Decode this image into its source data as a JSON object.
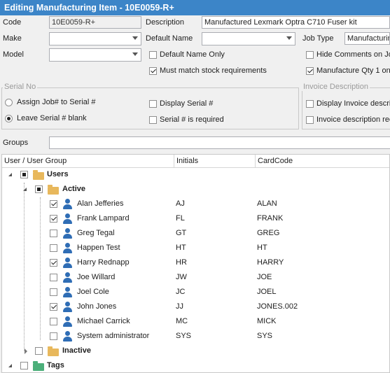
{
  "window": {
    "title": "Editing Manufacturing Item - 10E0059-R+"
  },
  "form": {
    "code_label": "Code",
    "code_value": "10E0059-R+",
    "description_label": "Description",
    "description_value": "Manufactured Lexmark Optra C710 Fuser kit",
    "make_label": "Make",
    "make_value": "",
    "default_name_label": "Default Name",
    "default_name_value": "",
    "job_type_label": "Job Type",
    "job_type_value": "Manufacturin",
    "model_label": "Model",
    "model_value": "",
    "default_name_only_label": "Default Name Only",
    "default_name_only_checked": false,
    "hide_comments_label": "Hide Comments on Jol",
    "hide_comments_checked": false,
    "must_match_label": "Must match stock requirements",
    "must_match_checked": true,
    "manufacture_qty_label": "Manufacture Qty 1 on",
    "manufacture_qty_checked": true
  },
  "serial_group": {
    "title": "Serial No",
    "assign_label": "Assign Job# to Serial #",
    "leave_blank_label": "Leave Serial # blank",
    "selected": "leave_blank",
    "display_serial_label": "Display Serial #",
    "serial_required_label": "Serial # is required"
  },
  "invoice_group": {
    "title": "Invoice Description",
    "display_invoice_label": "Display Invoice descri",
    "invoice_required_label": "Invoice description rec"
  },
  "groups": {
    "label": "Groups",
    "value": ""
  },
  "grid": {
    "columns": [
      "User / User Group",
      "Initials",
      "CardCode"
    ],
    "root": {
      "label": "Users"
    },
    "active": {
      "label": "Active"
    },
    "users": [
      {
        "name": "Alan Jefferies",
        "initials": "AJ",
        "card": "ALAN",
        "checked": true
      },
      {
        "name": "Frank Lampard",
        "initials": "FL",
        "card": "FRANK",
        "checked": true
      },
      {
        "name": "Greg Tegal",
        "initials": "GT",
        "card": "GREG",
        "checked": false
      },
      {
        "name": "Happen Test",
        "initials": "HT",
        "card": "HT",
        "checked": false
      },
      {
        "name": "Harry Rednapp",
        "initials": "HR",
        "card": "HARRY",
        "checked": true
      },
      {
        "name": "Joe Willard",
        "initials": "JW",
        "card": "JOE",
        "checked": false
      },
      {
        "name": "Joel Cole",
        "initials": "JC",
        "card": "JOEL",
        "checked": false
      },
      {
        "name": "John Jones",
        "initials": "JJ",
        "card": "JONES.002",
        "checked": true
      },
      {
        "name": "Michael Carrick",
        "initials": "MC",
        "card": "MICK",
        "checked": false
      },
      {
        "name": "System administrator",
        "initials": "SYS",
        "card": "SYS",
        "checked": false
      }
    ],
    "inactive": {
      "label": "Inactive"
    },
    "tags": {
      "label": "Tags"
    }
  },
  "colors": {
    "titlebar": "#3c85c8",
    "user_icon": "#2f6db5",
    "folder": "#e8b85c",
    "tag_folder": "#4caf7a"
  }
}
